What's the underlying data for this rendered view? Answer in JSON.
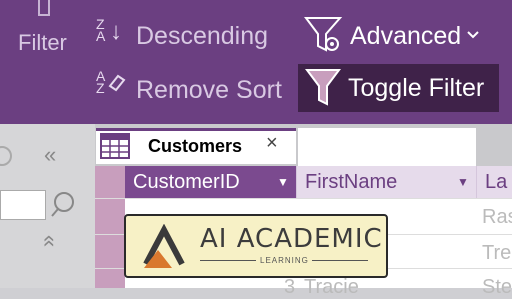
{
  "ribbon": {
    "filter_label": "Filter",
    "descending_label": "Descending",
    "remove_sort_label": "Remove Sort",
    "advanced_label": "Advanced",
    "toggle_filter_label": "Toggle Filter",
    "sort_z": "Z",
    "sort_a": "A",
    "colors": {
      "ribbon_bg": "#6b3f81",
      "active_button_bg": "#3f2249"
    }
  },
  "tab": {
    "label": "Customers",
    "close_glyph": "×"
  },
  "columns": [
    "CustomerID",
    "FirstName",
    "La"
  ],
  "rows": [
    {
      "first": "Ras"
    },
    {
      "first": "Tre"
    },
    {
      "id": "3",
      "first": "Tracie",
      "last": "Ste"
    }
  ],
  "watermark": {
    "title": "AI ACADEMIC",
    "subtitle": "LEARNING"
  }
}
